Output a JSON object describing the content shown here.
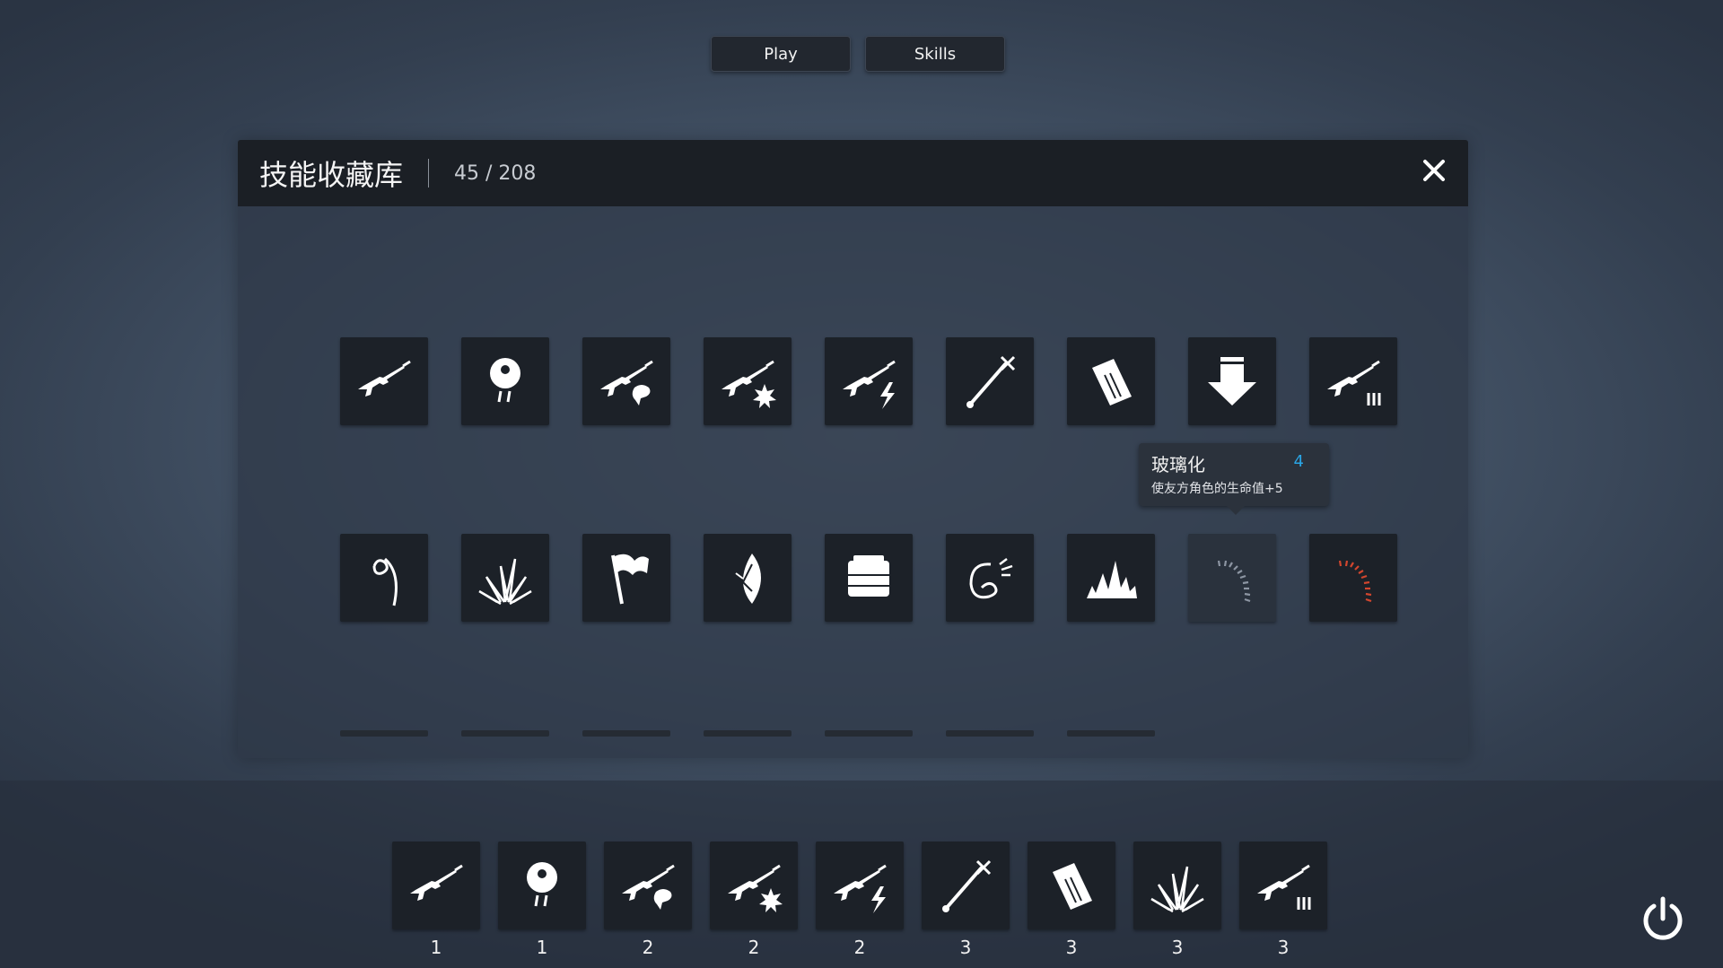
{
  "top_nav": {
    "play_label": "Play",
    "skills_label": "Skills"
  },
  "panel": {
    "title": "技能收藏库",
    "count": "45 / 208"
  },
  "collection": {
    "row1": [
      "rifle-icon",
      "bomb-icon",
      "rifle-fist-icon",
      "rifle-explosion-icon",
      "rifle-lightning-icon",
      "spear-icon",
      "ammo-magazine-icon",
      "arrow-down-icon",
      "rifle-level3-icon"
    ],
    "row2": [
      "hook-icon",
      "grass-icon",
      "flag-icon",
      "feather-icon",
      "block-icon",
      "whip-icon",
      "spikes-icon",
      "gauge-grey-icon",
      "gauge-red-icon"
    ],
    "empty_slots": 7
  },
  "tooltip": {
    "name": "玻璃化",
    "level": "4",
    "description": "使友方角色的生命值+5",
    "level_color": "#2aa6e6"
  },
  "loadout": [
    {
      "icon": "rifle-icon",
      "cost": "1"
    },
    {
      "icon": "bomb-icon",
      "cost": "1"
    },
    {
      "icon": "rifle-fist-icon",
      "cost": "2"
    },
    {
      "icon": "rifle-explosion-icon",
      "cost": "2"
    },
    {
      "icon": "rifle-lightning-icon",
      "cost": "2"
    },
    {
      "icon": "spear-icon",
      "cost": "3"
    },
    {
      "icon": "ammo-magazine-icon",
      "cost": "3"
    },
    {
      "icon": "grass-icon",
      "cost": "3"
    },
    {
      "icon": "rifle-level3-icon",
      "cost": "3"
    }
  ],
  "colors": {
    "accent_blue": "#2aa6e6",
    "gauge_red": "#d2462e",
    "tile_bg": "#1c2128"
  }
}
